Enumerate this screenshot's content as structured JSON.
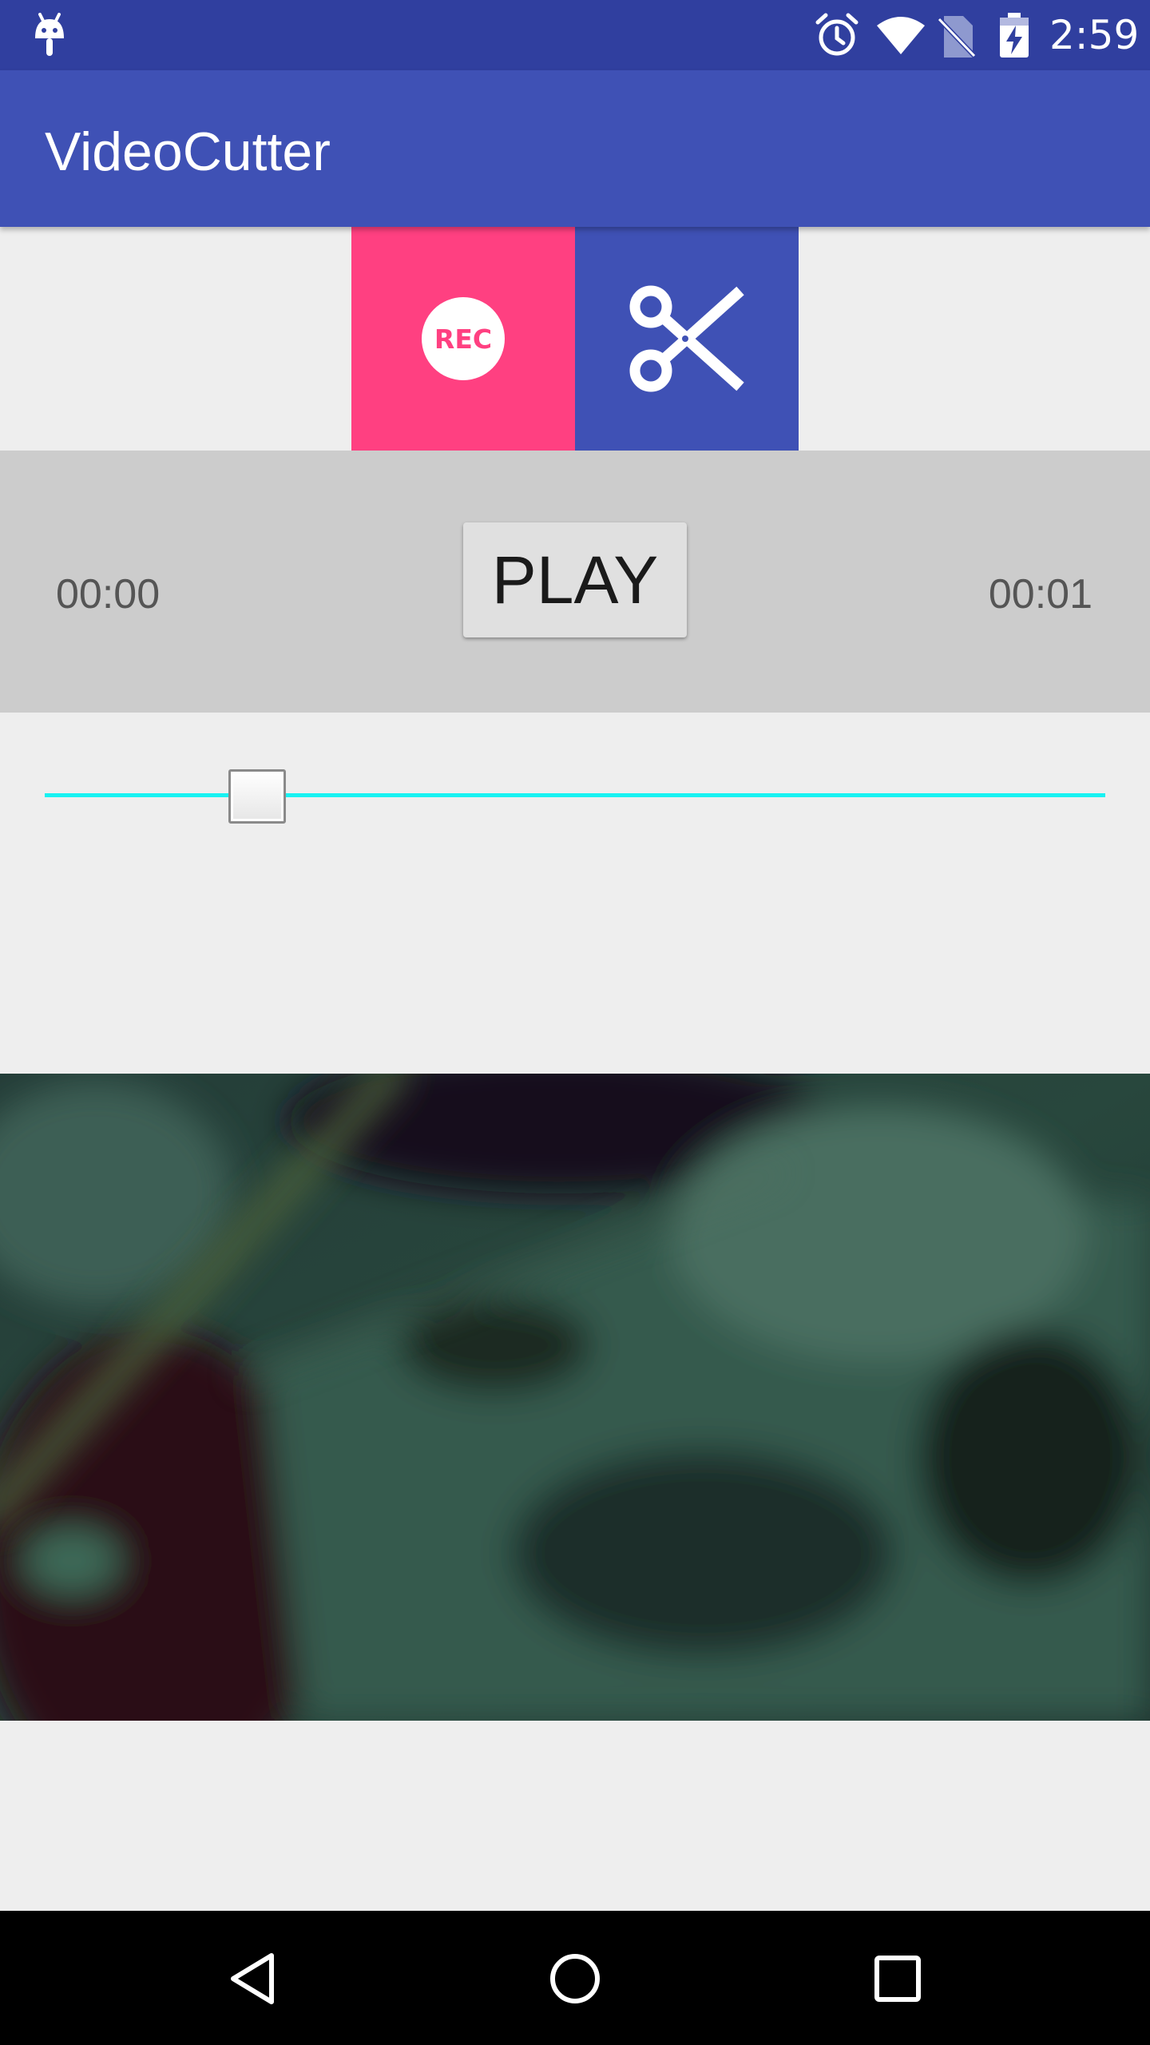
{
  "status_bar": {
    "time": "2:59",
    "icons": [
      "android-debug-icon",
      "alarm-icon",
      "wifi-icon",
      "no-sim-icon",
      "battery-charging-icon"
    ]
  },
  "app_bar": {
    "title": "VideoCutter"
  },
  "actions": {
    "rec_label": "REC",
    "rec_color": "#ff4081",
    "cut_icon": "scissors-icon",
    "cut_color": "#3f51b5"
  },
  "player": {
    "start_time": "00:00",
    "end_time": "00:01",
    "play_label": "PLAY",
    "seek_position": 0.2,
    "track_color": "#18f2f2"
  },
  "video": {
    "content": "video-preview"
  },
  "nav_bar": {
    "icons": [
      "back-icon",
      "home-icon",
      "recents-icon"
    ]
  },
  "colors": {
    "primary": "#3f51b5",
    "primary_dark": "#303f9f",
    "accent": "#ff4081"
  }
}
